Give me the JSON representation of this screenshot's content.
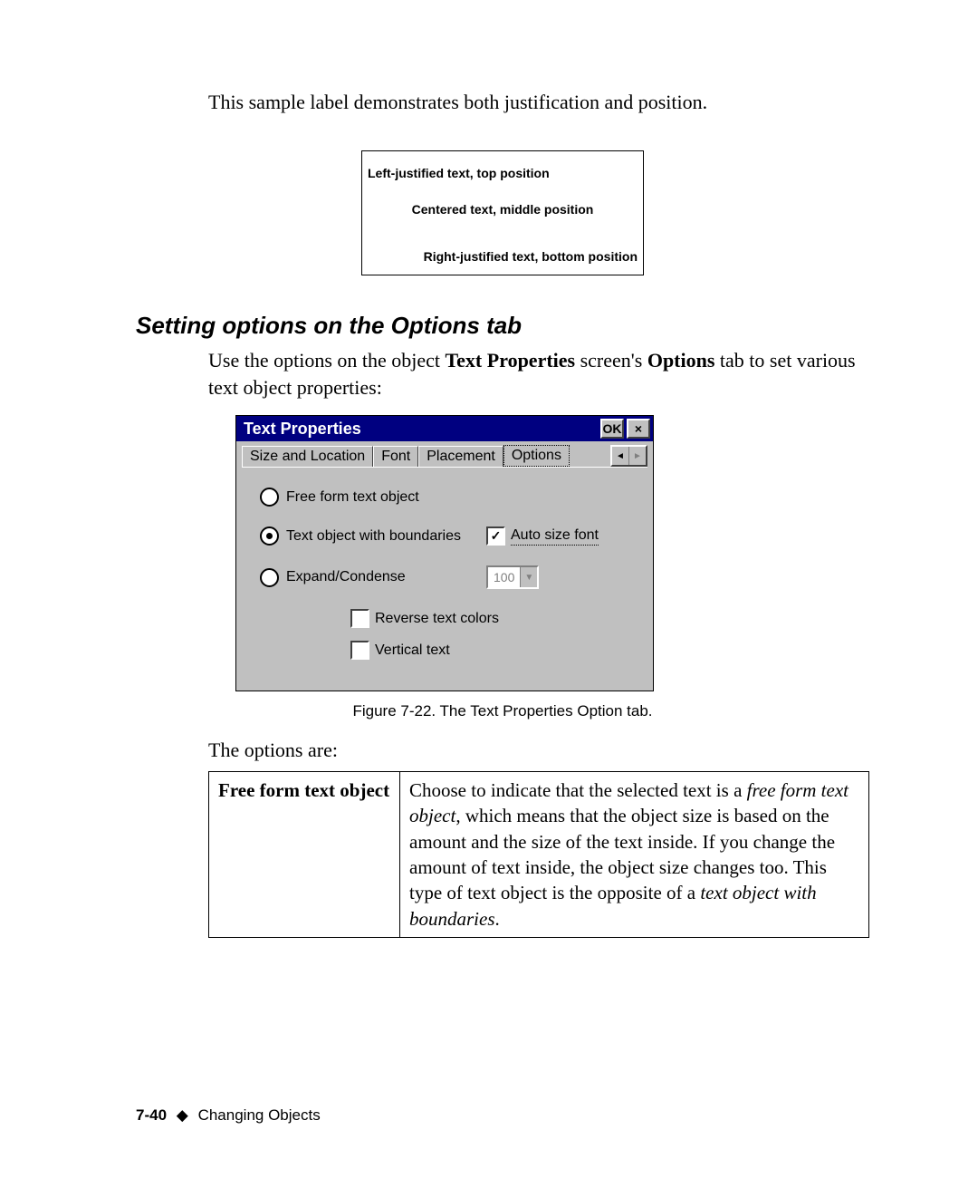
{
  "intro": "This sample label demonstrates both justification and position.",
  "sample": {
    "left": "Left-justified text, top position",
    "center": "Centered text, middle position",
    "right": "Right-justified text, bottom position"
  },
  "section_heading": "Setting options on the Options tab",
  "section_body_pre": "Use the options on the object ",
  "section_body_b1": "Text Properties",
  "section_body_mid": " screen's ",
  "section_body_b2": "Options",
  "section_body_post": " tab to set various text object properties:",
  "dialog": {
    "title": "Text Properties",
    "ok": "OK",
    "close": "×",
    "tabs": {
      "t0": "Size and Location",
      "t1": "Font",
      "t2": "Placement",
      "t3": "Options"
    },
    "scroll_left": "◄",
    "scroll_right": "►",
    "opts": {
      "free_form": "Free form text object",
      "with_bounds": "Text object with boundaries",
      "auto_size": "Auto size font",
      "expand": "Expand/Condense",
      "expand_val": "100",
      "reverse": "Reverse text colors",
      "vertical": "Vertical text"
    }
  },
  "figure_caption": "Figure 7-22. The Text Properties Option tab.",
  "options_intro": "The options are:",
  "table_term": "Free form text object",
  "table_desc": {
    "pre": "Choose to indicate that the selected text is a ",
    "ital1": "free form text object",
    "mid": ", which means that the object size is based on the amount and the size of the text inside. If you change the amount of text inside, the object size changes too. This type of text object is the opposite of a ",
    "ital2": "text object with boundaries",
    "post": "."
  },
  "footer": {
    "page": "7-40",
    "diamond": "◆",
    "chapter": "Changing Objects"
  }
}
